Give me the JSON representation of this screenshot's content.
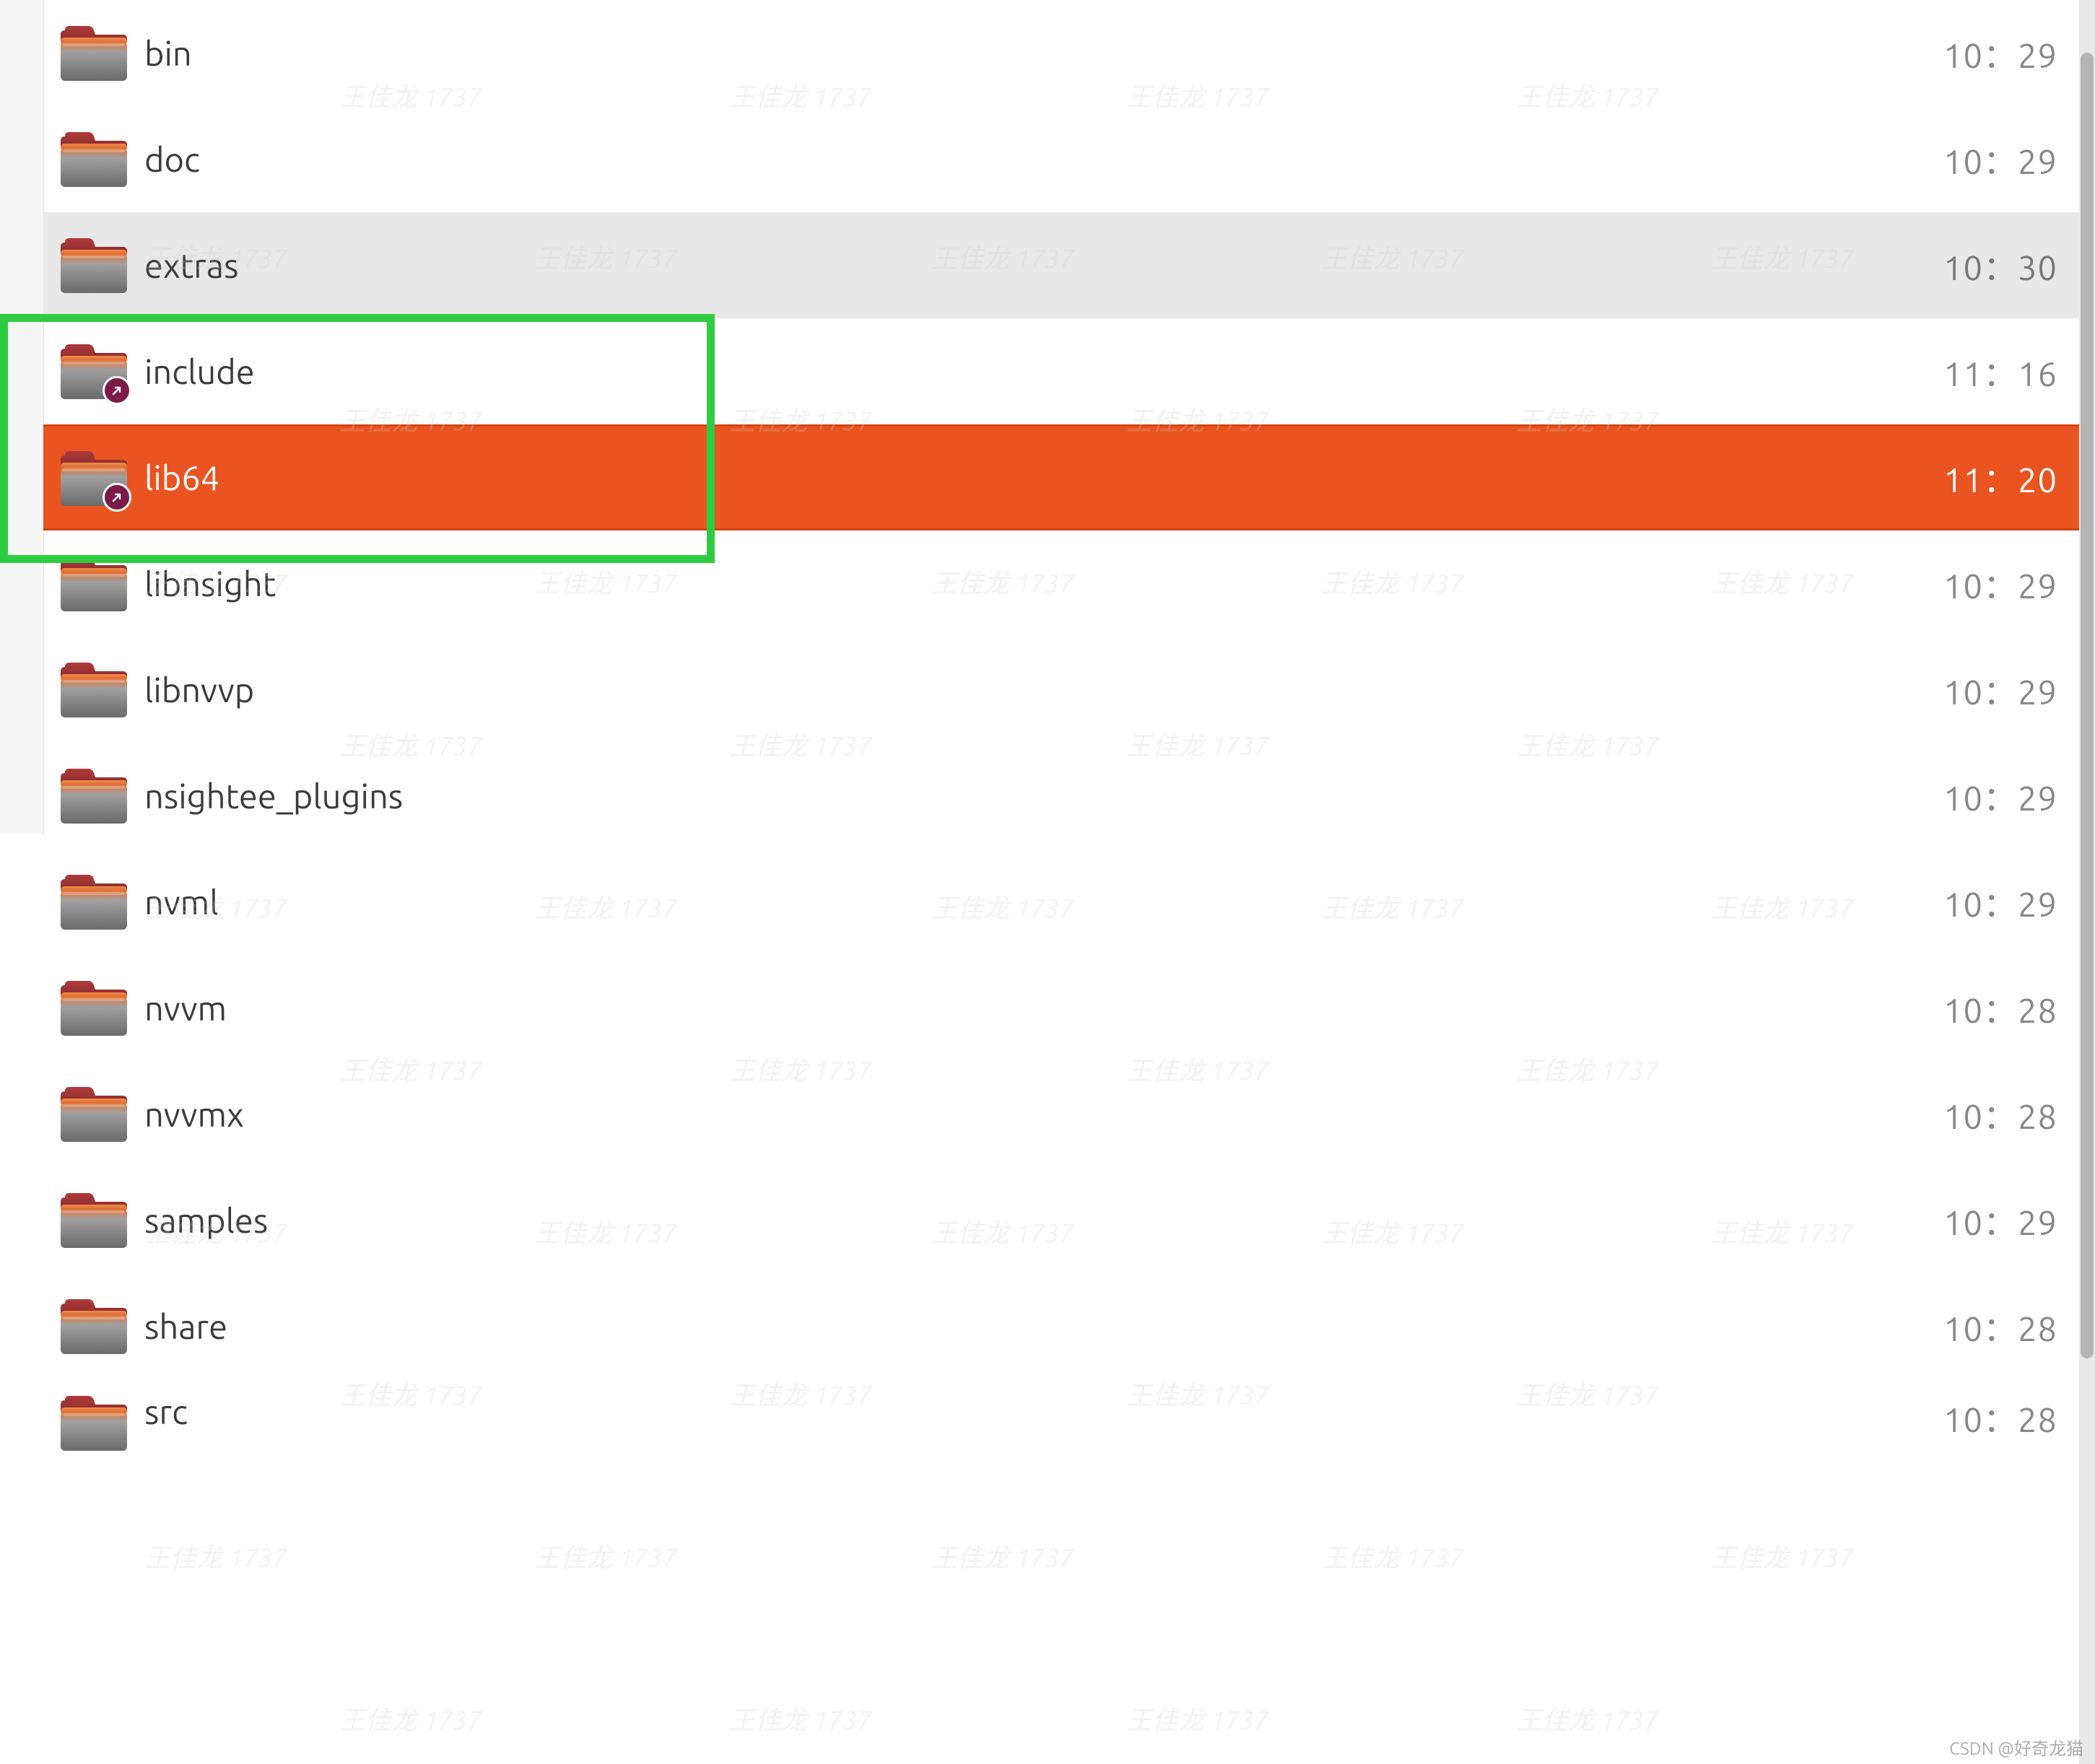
{
  "watermark_text": "王佳龙 1737",
  "footer_watermark": "CSDN @好奇龙猫",
  "colors": {
    "selection": "#e95420",
    "selection_border": "#d34515",
    "highlight_box": "#2ecc40",
    "symlink_badge": "#7b1a46"
  },
  "highlight_box": {
    "covers_rows": [
      "include",
      "lib64"
    ]
  },
  "scrollbar": {
    "thumb_top_pct": 3,
    "thumb_height_pct": 74
  },
  "rows": [
    {
      "name": "bin",
      "time": "10：29",
      "symlink": false,
      "state": "normal"
    },
    {
      "name": "doc",
      "time": "10：29",
      "symlink": false,
      "state": "normal"
    },
    {
      "name": "extras",
      "time": "10：30",
      "symlink": false,
      "state": "hover"
    },
    {
      "name": "include",
      "time": "11：16",
      "symlink": true,
      "state": "normal"
    },
    {
      "name": "lib64",
      "time": "11：20",
      "symlink": true,
      "state": "selected"
    },
    {
      "name": "libnsight",
      "time": "10：29",
      "symlink": false,
      "state": "normal"
    },
    {
      "name": "libnvvp",
      "time": "10：29",
      "symlink": false,
      "state": "normal"
    },
    {
      "name": "nsightee_plugins",
      "time": "10：29",
      "symlink": false,
      "state": "normal"
    },
    {
      "name": "nvml",
      "time": "10：29",
      "symlink": false,
      "state": "normal"
    },
    {
      "name": "nvvm",
      "time": "10：28",
      "symlink": false,
      "state": "normal"
    },
    {
      "name": "nvvmx",
      "time": "10：28",
      "symlink": false,
      "state": "normal"
    },
    {
      "name": "samples",
      "time": "10：29",
      "symlink": false,
      "state": "normal"
    },
    {
      "name": "share",
      "time": "10：28",
      "symlink": false,
      "state": "normal"
    },
    {
      "name": "src",
      "time": "10：28",
      "symlink": false,
      "state": "partial"
    }
  ]
}
